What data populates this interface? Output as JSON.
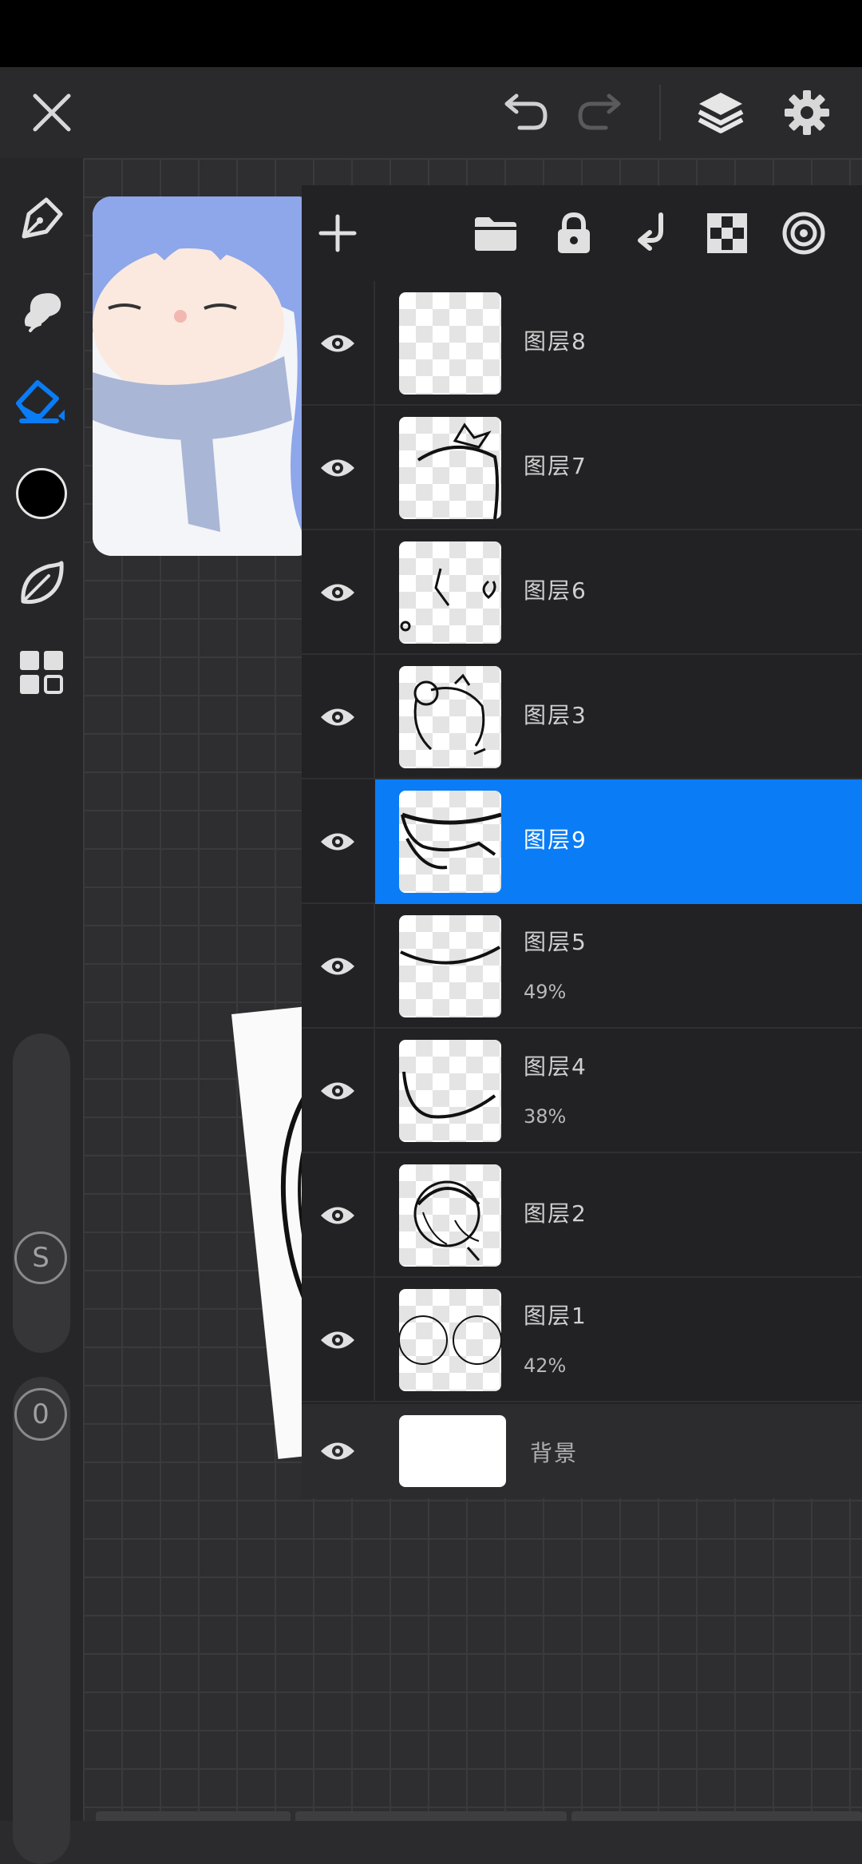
{
  "toolbar": {
    "close_icon": "close-icon",
    "undo_icon": "undo-icon",
    "redo_icon": "redo-icon",
    "layers_icon": "layers-icon",
    "settings_icon": "gear-icon"
  },
  "sidebar": {
    "tools": [
      "pen-icon",
      "smudge-icon",
      "eraser-icon",
      "color-swatch",
      "leaf-icon",
      "grid-icon"
    ],
    "active_tool": "eraser-icon",
    "accent": "#0a7cf6",
    "color": "#000000",
    "size_knob_label": "S",
    "opacity_knob_label": "0"
  },
  "layers_panel": {
    "header_icons": [
      "add-icon",
      "folder-icon",
      "lock-icon",
      "merge-down-icon",
      "checker-icon",
      "target-icon"
    ],
    "layers": [
      {
        "name": "图层8",
        "opacity": "",
        "selected": false
      },
      {
        "name": "图层7",
        "opacity": "",
        "selected": false
      },
      {
        "name": "图层6",
        "opacity": "",
        "selected": false
      },
      {
        "name": "图层3",
        "opacity": "",
        "selected": false
      },
      {
        "name": "图层9",
        "opacity": "",
        "selected": true
      },
      {
        "name": "图层5",
        "opacity": "49%",
        "selected": false
      },
      {
        "name": "图层4",
        "opacity": "38%",
        "selected": false
      },
      {
        "name": "图层2",
        "opacity": "",
        "selected": false
      },
      {
        "name": "图层1",
        "opacity": "42%",
        "selected": false
      }
    ],
    "background_layer": {
      "name": "背景"
    }
  }
}
